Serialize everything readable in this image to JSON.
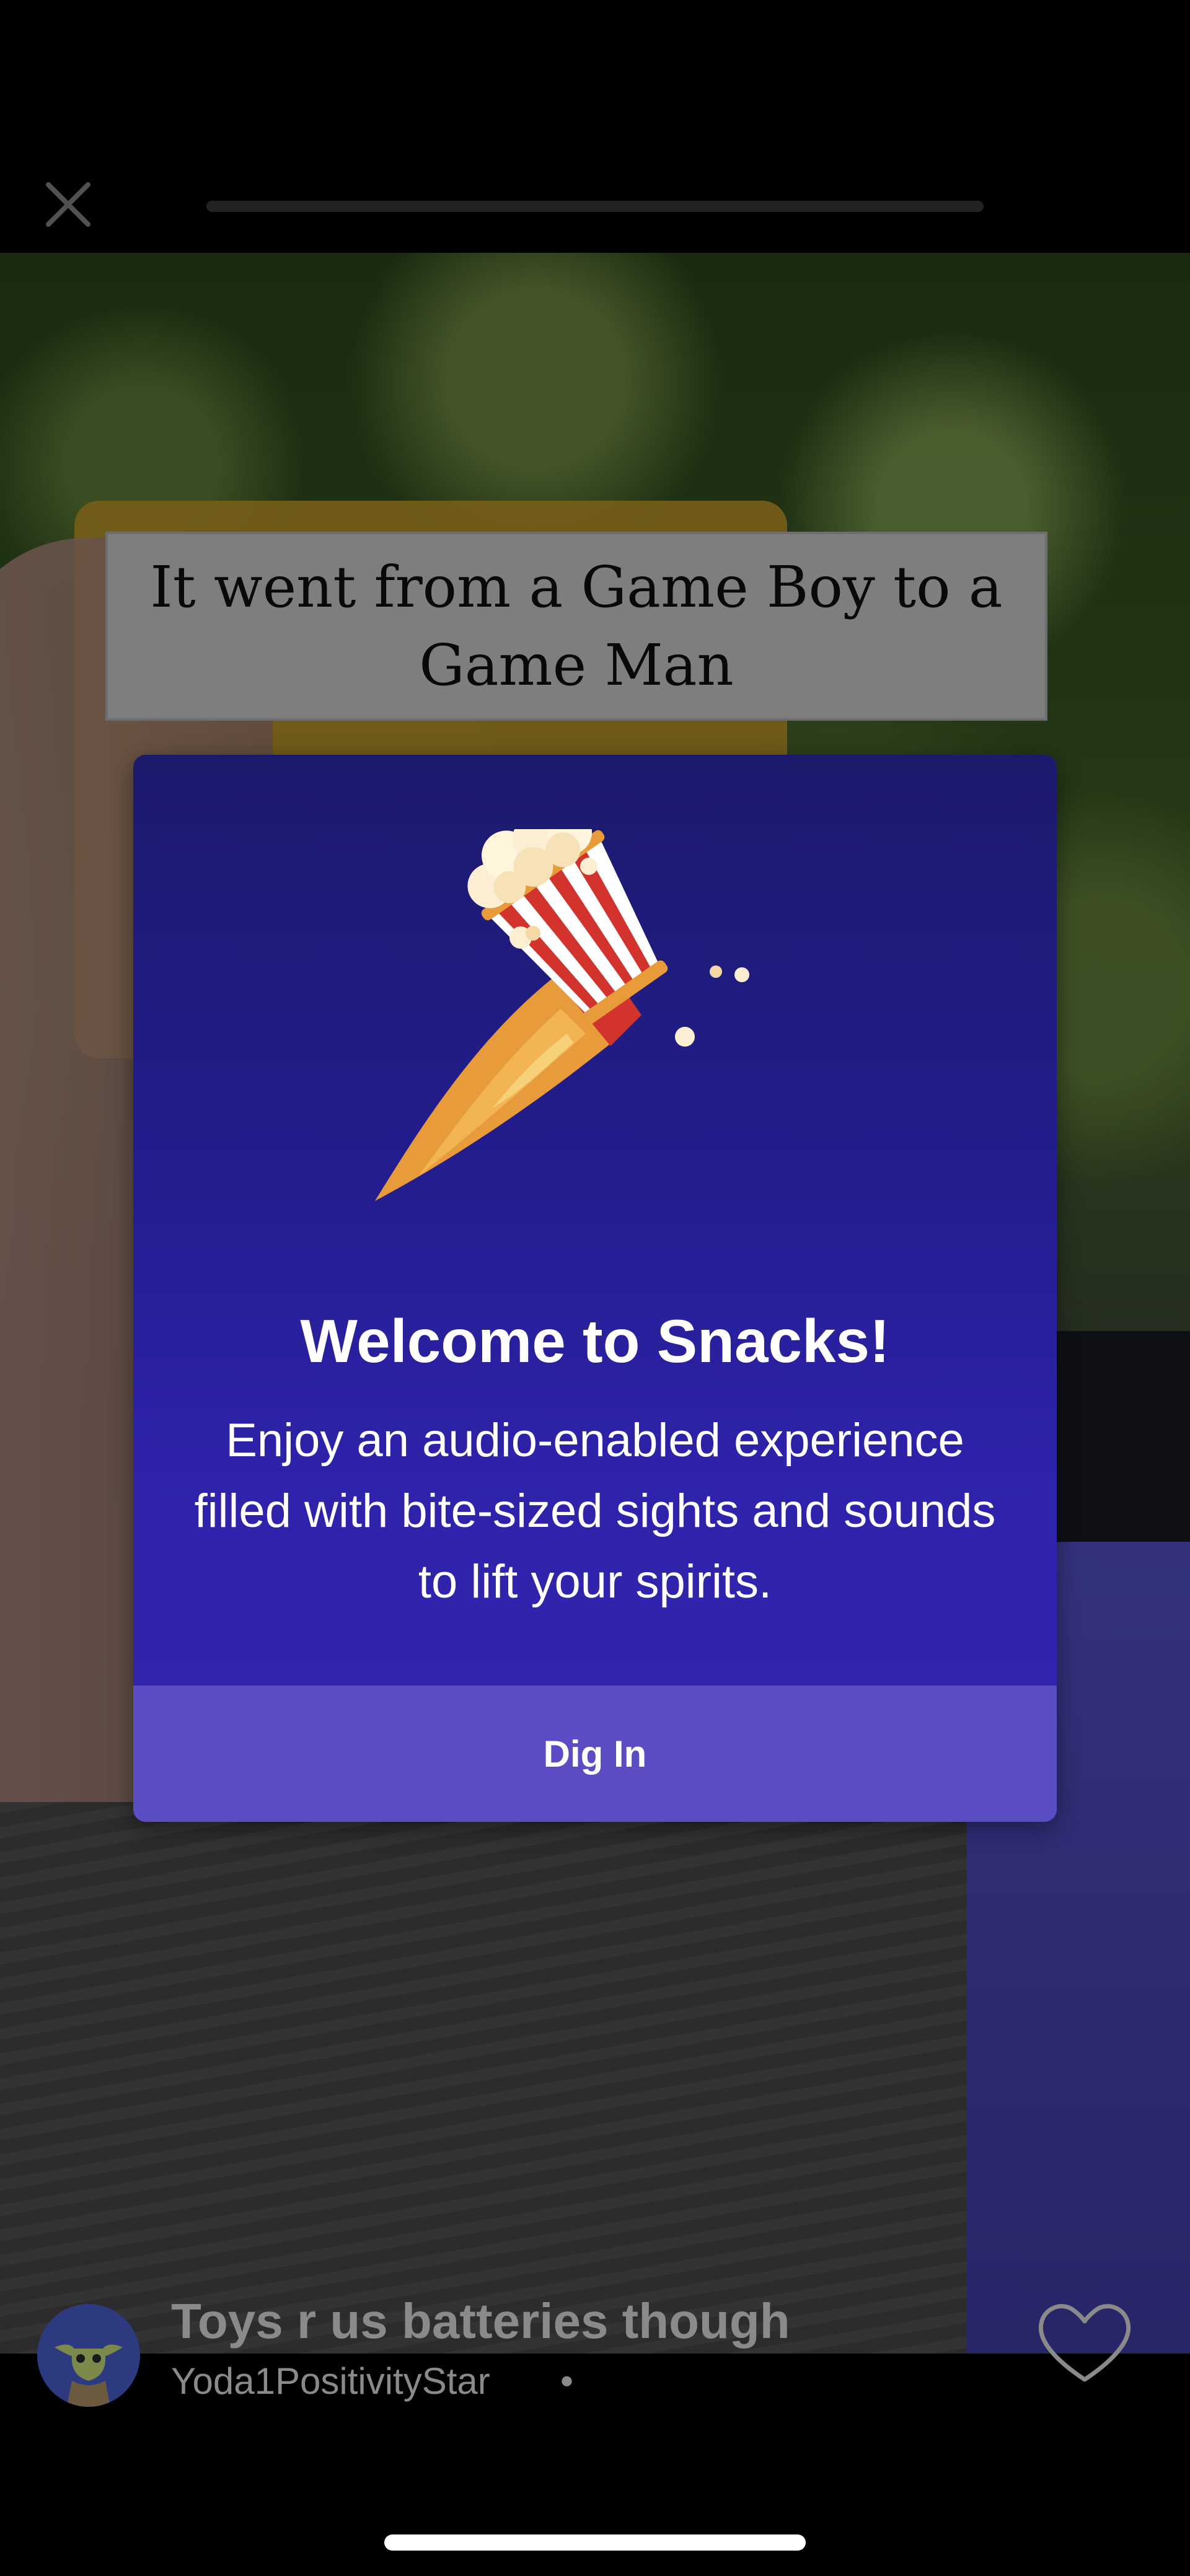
{
  "top_bar": {
    "close_icon": "close-icon",
    "progress": 0.0
  },
  "video": {
    "caption": "It went from a Game Boy to a Game Man"
  },
  "modal": {
    "illustration_icon": "popcorn-rocket-icon",
    "title": "Welcome to Snacks!",
    "body": "Enjoy an audio-enabled experience filled with bite-sized sights and sounds to lift your spirits.",
    "action_label": "Dig In"
  },
  "post": {
    "avatar_icon": "yoda-avatar",
    "title": "Toys r us batteries though",
    "author": "Yoda1PositivityStar",
    "separator": "•",
    "like_icon": "heart-icon"
  },
  "colors": {
    "modal_top": "#1c1a6c",
    "modal_bottom": "#3225ae",
    "action_bar": "#5a4cc2",
    "background": "#000000"
  }
}
